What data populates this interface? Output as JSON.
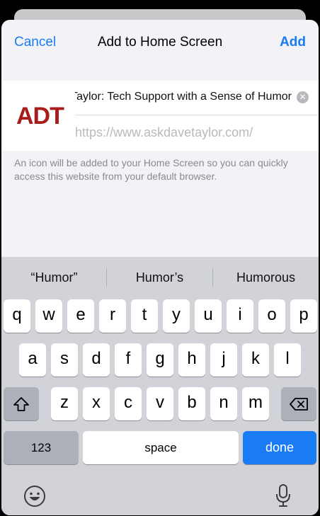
{
  "sheet": {
    "cancel_label": "Cancel",
    "title": "Add to Home Screen",
    "add_label": "Add"
  },
  "form": {
    "icon_text": "ADT",
    "name_value": "Ask Dave Taylor: Tech Support with a Sense of Humor",
    "url_value": "https://www.askdavetaylor.com/",
    "clear_icon": "clear-circle-icon"
  },
  "info_text": "An icon will be added to your Home Screen so you can quickly access this website from your default browser.",
  "keyboard": {
    "suggestions": [
      "“Humor”",
      "Humor’s",
      "Humorous"
    ],
    "row1": [
      "q",
      "w",
      "e",
      "r",
      "t",
      "y",
      "u",
      "i",
      "o",
      "p"
    ],
    "row2": [
      "a",
      "s",
      "d",
      "f",
      "g",
      "h",
      "j",
      "k",
      "l"
    ],
    "row3": [
      "z",
      "x",
      "c",
      "v",
      "b",
      "n",
      "m"
    ],
    "numbers_label": "123",
    "space_label": "space",
    "done_label": "done",
    "shift_icon": "shift-icon",
    "delete_icon": "delete-icon",
    "emoji_icon": "emoji-icon",
    "mic_icon": "microphone-icon",
    "accent_color": "#1a7cf5"
  }
}
